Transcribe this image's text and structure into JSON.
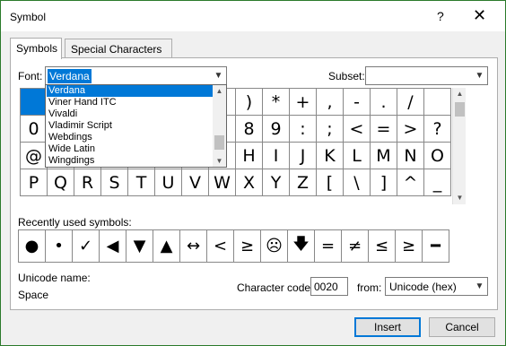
{
  "window": {
    "title": "Symbol",
    "help_glyph": "?",
    "close_glyph": "✕"
  },
  "tabs": [
    {
      "label": "Symbols",
      "active": true
    },
    {
      "label": "Special Characters",
      "active": false
    }
  ],
  "font": {
    "label": "Font:",
    "value": "Verdana"
  },
  "subset": {
    "label": "Subset:",
    "value": ""
  },
  "font_list": [
    "Verdana",
    "Viner Hand ITC",
    "Vivaldi",
    "Vladimir Script",
    "Webdings",
    "Wide Latin",
    "Wingdings"
  ],
  "symbol_rows": [
    [
      "",
      "",
      "",
      "",
      "",
      "",
      "",
      "(",
      ")",
      "*",
      "+",
      ",",
      "-",
      ".",
      "/",
      ""
    ],
    [
      "0",
      "",
      "",
      "",
      "",
      "",
      "",
      "",
      "8",
      "9",
      ":",
      ";",
      "<",
      "=",
      ">",
      "?"
    ],
    [
      "@",
      "",
      "",
      "",
      "",
      "",
      "",
      "",
      "H",
      "I",
      "J",
      "K",
      "L",
      "M",
      "N",
      "O"
    ],
    [
      "P",
      "Q",
      "R",
      "S",
      "T",
      "U",
      "V",
      "W",
      "X",
      "Y",
      "Z",
      "[",
      "\\",
      "]",
      "^",
      "_"
    ]
  ],
  "recently_used": {
    "label": "Recently used symbols:",
    "symbols": [
      "●",
      "•",
      "✓",
      "◀",
      "▼",
      "▲",
      "↔",
      "<",
      "≥",
      "☹",
      "🡇",
      "=",
      "≠",
      "≤",
      "≥",
      "━"
    ]
  },
  "unicode_name": {
    "label": "Unicode name:",
    "value": "Space"
  },
  "character_code": {
    "label": "Character code:",
    "value": "0020"
  },
  "from": {
    "label": "from:",
    "value": "Unicode (hex)"
  },
  "buttons": {
    "insert": "Insert",
    "cancel": "Cancel"
  },
  "icons": {
    "dropdown_arrow": "chevron-down-icon",
    "scroll_up": "scroll-up-icon",
    "scroll_down": "scroll-down-icon"
  },
  "colors": {
    "selection": "#0078d7",
    "window_border": "#2b7a2b"
  }
}
